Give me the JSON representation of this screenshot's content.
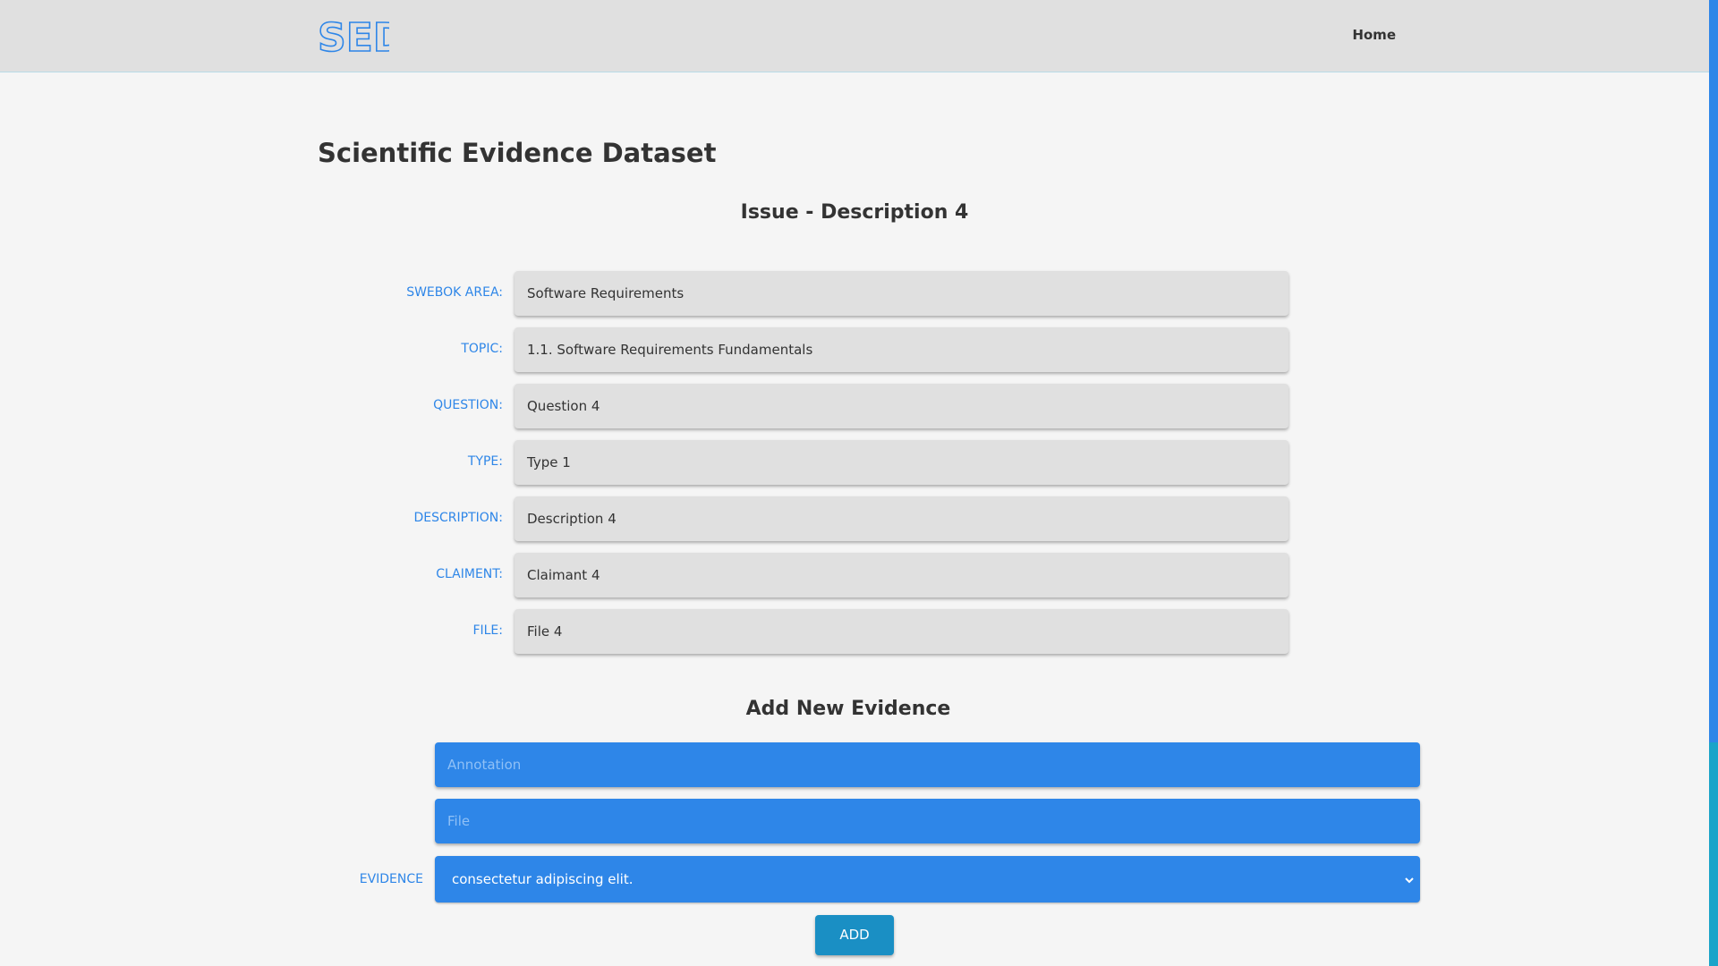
{
  "header": {
    "logo_text": "SED",
    "nav_home": "Home"
  },
  "page": {
    "title": "Scientific Evidence Dataset",
    "issue_title": "Issue - Description 4"
  },
  "fields": [
    {
      "label": "SWEBOK AREA:",
      "value": "Software Requirements"
    },
    {
      "label": "TOPIC:",
      "value": "1.1. Software Requirements Fundamentals"
    },
    {
      "label": "QUESTION:",
      "value": "Question 4"
    },
    {
      "label": "TYPE:",
      "value": "Type 1"
    },
    {
      "label": "DESCRIPTION:",
      "value": "Description 4"
    },
    {
      "label": "CLAIMENT:",
      "value": "Claimant 4"
    },
    {
      "label": "FILE:",
      "value": "File 4"
    }
  ],
  "add_evidence": {
    "title": "Add New Evidence",
    "annotation_placeholder": "Annotation",
    "file_placeholder": "File",
    "evidence_label": "EVIDENCE",
    "evidence_selected": "consectetur adipiscing elit.",
    "add_button": "ADD"
  },
  "colors": {
    "accent": "#2e86e8",
    "button": "#1a8fc4",
    "navbar": "#e0e0e0",
    "background": "#f5f5f5"
  },
  "icons": {
    "logo": "sed-logo",
    "select_chevron": "chevron-down-icon"
  }
}
